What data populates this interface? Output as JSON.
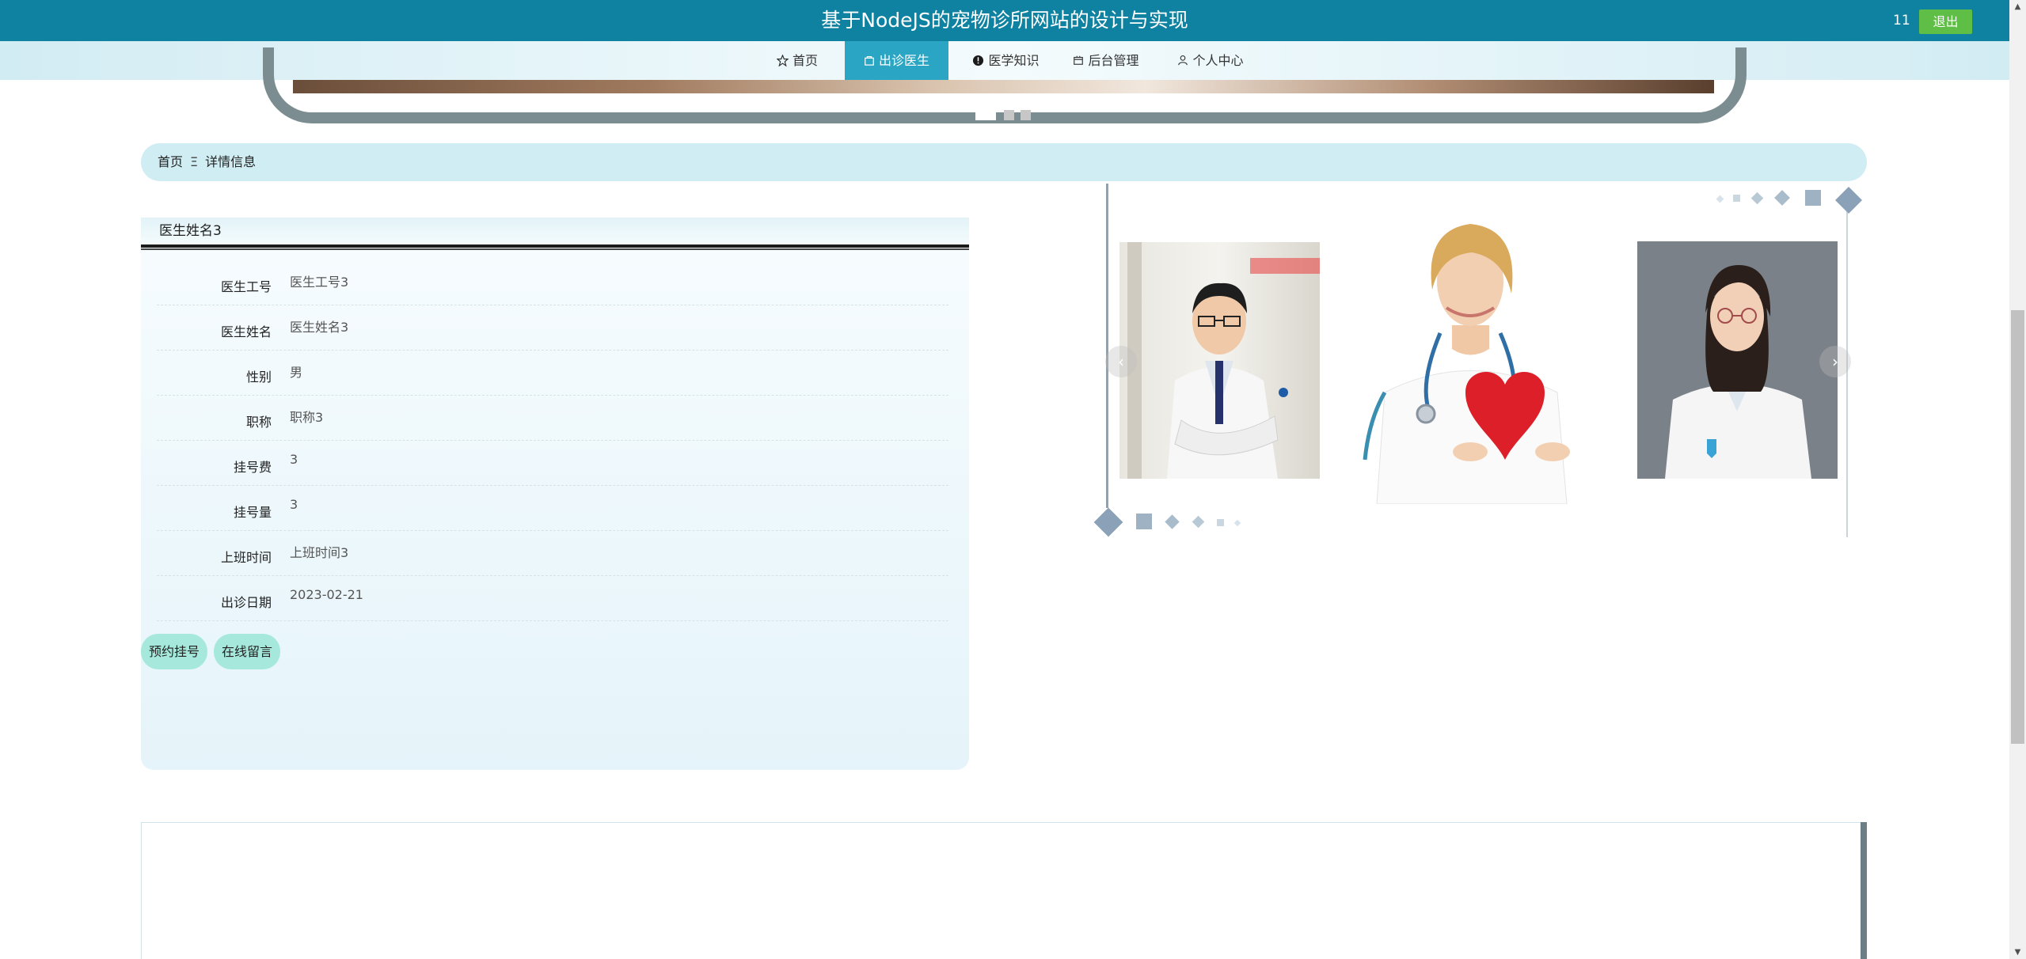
{
  "header": {
    "title": "基于NodeJS的宠物诊所网站的设计与实现",
    "user": "11",
    "logout_label": "退出"
  },
  "nav": {
    "items": [
      {
        "label": "首页",
        "icon": "star-icon"
      },
      {
        "label": "出诊医生",
        "icon": "bag-icon",
        "active": true
      },
      {
        "label": "医学知识",
        "icon": "info-icon"
      },
      {
        "label": "后台管理",
        "icon": "box-icon"
      },
      {
        "label": "个人中心",
        "icon": "user-icon"
      }
    ]
  },
  "breadcrumb": {
    "home": "首页",
    "separator": "Ξ",
    "current": "详情信息"
  },
  "detail": {
    "title": "医生姓名3",
    "fields": [
      {
        "label": "医生工号",
        "value": "医生工号3"
      },
      {
        "label": "医生姓名",
        "value": "医生姓名3"
      },
      {
        "label": "性别",
        "value": "男"
      },
      {
        "label": "职称",
        "value": "职称3"
      },
      {
        "label": "挂号费",
        "value": "3"
      },
      {
        "label": "挂号量",
        "value": "3"
      },
      {
        "label": "上班时间",
        "value": "上班时间3"
      },
      {
        "label": "出诊日期",
        "value": "2023-02-21"
      }
    ],
    "actions": {
      "book_label": "预约挂号",
      "message_label": "在线留言"
    }
  },
  "carousel": {
    "prev_label": "‹",
    "next_label": "›",
    "images": [
      "doctor-male-glasses",
      "nurse-holding-heart",
      "doctor-female-glasses"
    ]
  },
  "colors": {
    "topbar": "#0e82a0",
    "nav_active": "#2aa5c3",
    "logout": "#5fbe45",
    "breadcrumb_bg": "#cfedf3",
    "action_btn": "#a6e9dc"
  }
}
